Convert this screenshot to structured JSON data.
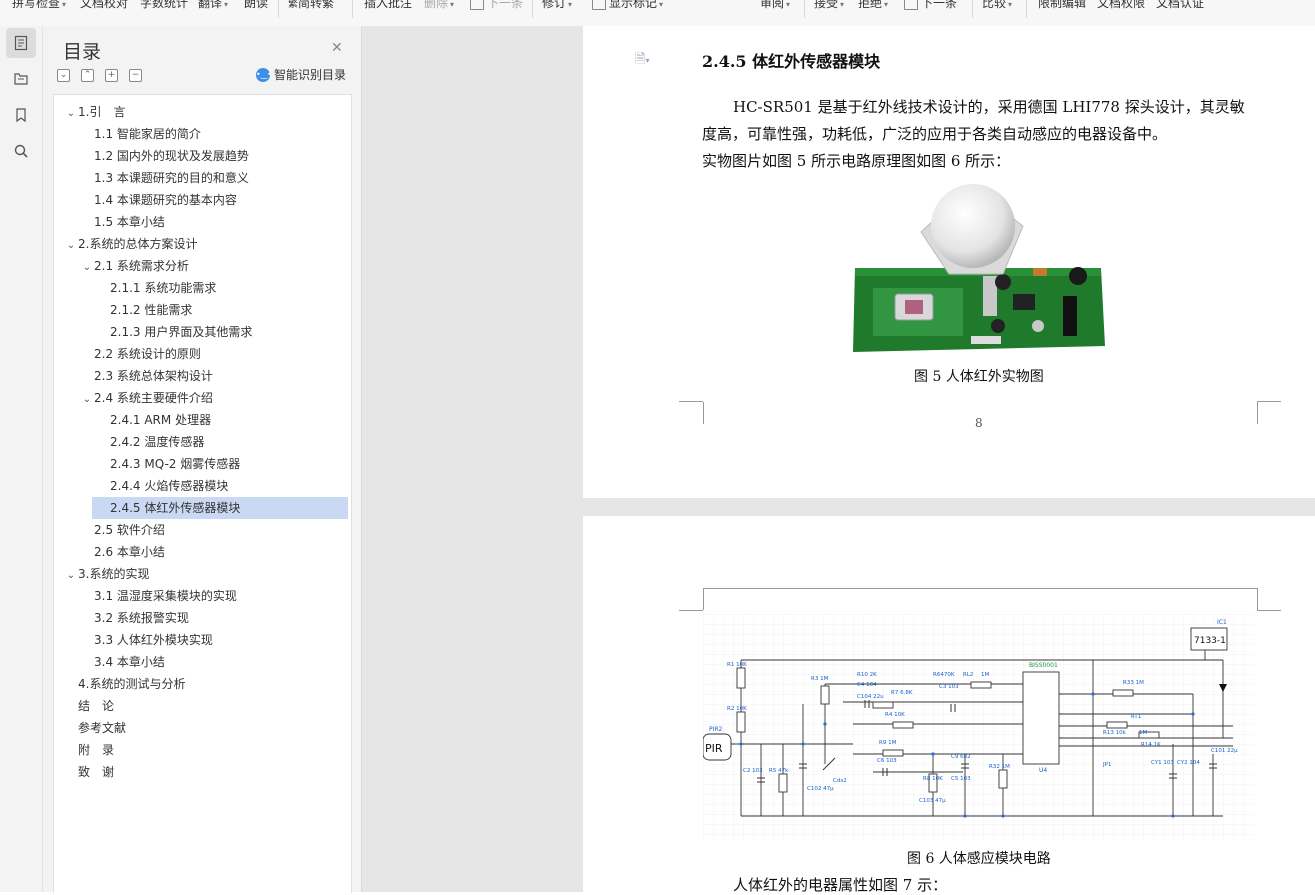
{
  "toolbar": {
    "spell_check": "拼写检查",
    "doc_proof": "文档校对",
    "word_count": "字数统计",
    "translate": "翻译",
    "read_aloud": "朗读",
    "simp_trad": "简转繁",
    "insert_comment": "插入批注",
    "delete": "删除",
    "next_item": "下一条",
    "track_changes": "修订",
    "show_markup": "显示标记",
    "review": "审阅",
    "accept": "接受",
    "reject": "拒绝",
    "next_change": "下一条",
    "compare": "比较",
    "restrict_edit": "限制编辑",
    "doc_rights": "文档权限",
    "doc_auth": "文档认证"
  },
  "toc": {
    "title": "目录",
    "smart_label": "智能识别目录",
    "items": [
      {
        "label": "1.引　言",
        "level": 1,
        "expanded": true
      },
      {
        "label": "1.1  智能家居的简介",
        "level": 2
      },
      {
        "label": "1.2  国内外的现状及发展趋势",
        "level": 2
      },
      {
        "label": "1.3  本课题研究的目的和意义",
        "level": 2
      },
      {
        "label": "1.4  本课题研究的基本内容",
        "level": 2
      },
      {
        "label": "1.5  本章小结",
        "level": 2
      },
      {
        "label": "2.系统的总体方案设计",
        "level": 1,
        "expanded": true
      },
      {
        "label": "2.1  系统需求分析",
        "level": 2,
        "expanded": true
      },
      {
        "label": "2.1.1  系统功能需求",
        "level": 3
      },
      {
        "label": "2.1.2  性能需求",
        "level": 3
      },
      {
        "label": "2.1.3  用户界面及其他需求",
        "level": 3
      },
      {
        "label": "2.2  系统设计的原则",
        "level": 2
      },
      {
        "label": "2.3  系统总体架构设计",
        "level": 2
      },
      {
        "label": "2.4  系统主要硬件介绍",
        "level": 2,
        "expanded": true
      },
      {
        "label": "2.4.1 ARM 处理器",
        "level": 3
      },
      {
        "label": "2.4.2  温度传感器",
        "level": 3
      },
      {
        "label": "2.4.3 MQ-2 烟雾传感器",
        "level": 3
      },
      {
        "label": "2.4.4  火焰传感器模块",
        "level": 3
      },
      {
        "label": "2.4.5  体红外传感器模块",
        "level": 3,
        "selected": true
      },
      {
        "label": "2.5  软件介绍",
        "level": 2
      },
      {
        "label": "2.6  本章小结",
        "level": 2
      },
      {
        "label": "3.系统的实现",
        "level": 1,
        "expanded": true
      },
      {
        "label": "3.1  温湿度采集模块的实现",
        "level": 2
      },
      {
        "label": "3.2  系统报警实现",
        "level": 2
      },
      {
        "label": "3.3  人体红外模块实现",
        "level": 2
      },
      {
        "label": "3.4  本章小结",
        "level": 2
      },
      {
        "label": "4.系统的测试与分析",
        "level": 1
      },
      {
        "label": "结　论",
        "level": 1
      },
      {
        "label": "参考文献",
        "level": 1
      },
      {
        "label": "附　录",
        "level": 1
      },
      {
        "label": "致　谢",
        "level": 1
      }
    ]
  },
  "document": {
    "heading": "2.4.5  体红外传感器模块",
    "para1_line1": "HC-SR501 是基于红外线技术设计的，采用德国 LHI778 探头设计，其灵敏",
    "para1_line2": "度高，可靠性强，功耗低，广泛的应用于各类自动感应的电器设备中。",
    "para2": "实物图片如图 5 所示电路原理图如图 6 所示：",
    "fig5_caption": "图 5  人体红外实物图",
    "page_number": "8",
    "fig6_caption": "图 6  人体感应模块电路",
    "para3": "人体红外的电器属性如图 7 示：",
    "schematic": {
      "ic1": "IC1",
      "reg": "7133-1",
      "chip": "BISS0001",
      "u4": "U4",
      "pir": "PIR",
      "pir2": "PIR2",
      "labels": [
        "R1 10K",
        "R2 10K",
        "R3 1M",
        "R5 47k",
        "C2 103",
        "C102 47μ",
        "Cds2",
        "C104 22u",
        "R10 2K",
        "C4 104",
        "R7 6.8K",
        "R6470K",
        "C3 103",
        "RL2",
        "1M",
        "R4 10K",
        "R9 1M",
        "C6 103",
        "R8 10K",
        "C103 47μ",
        "C9 682",
        "C5 103",
        "R32 1M",
        "R33 1M",
        "RT1",
        "R13 10k",
        "1M",
        "R14 1K",
        "JP1",
        "CY1 103",
        "CY2 104",
        "C101 22μ"
      ]
    }
  },
  "colors": {
    "toc_selected": "#c9d9f4",
    "canvas_gray": "#e6e6e6",
    "smart_icon": "#3d8fe8"
  }
}
